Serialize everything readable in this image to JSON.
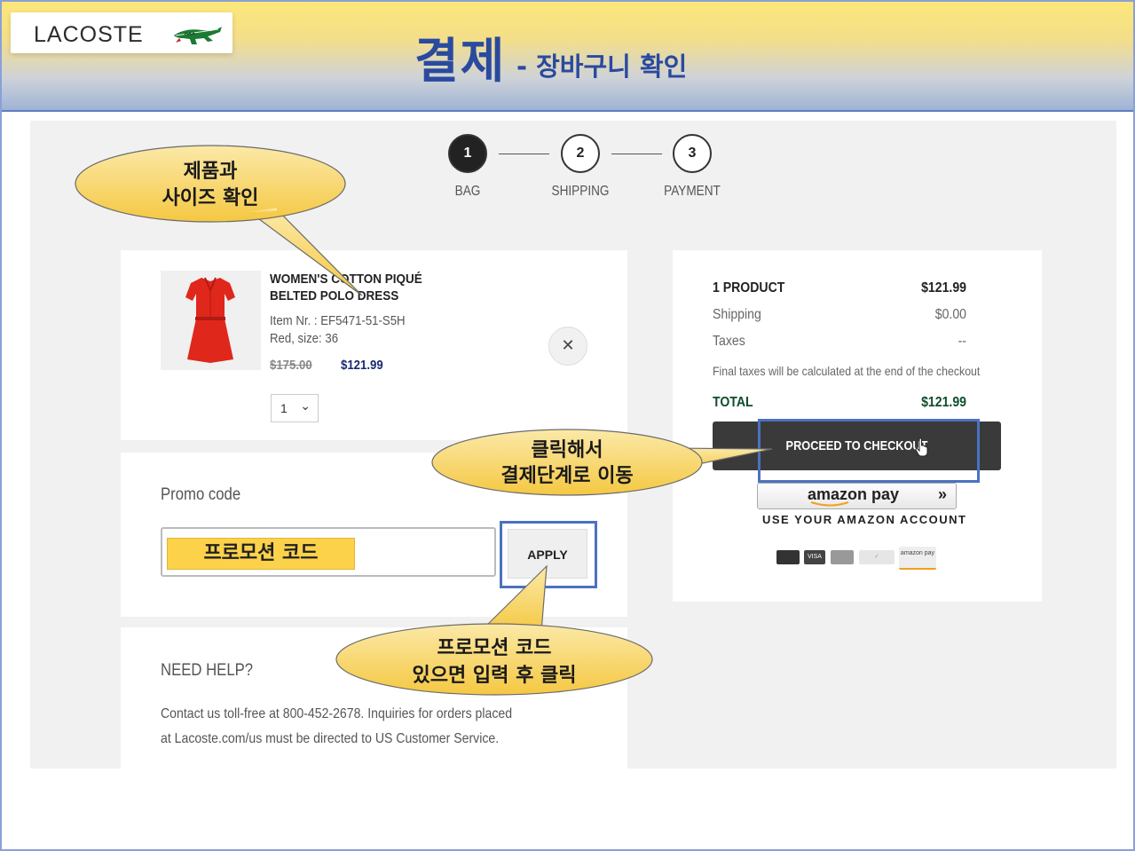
{
  "header": {
    "logo_text": "LACOSTE",
    "title": "결제",
    "subtitle": "- 장바구니 확인",
    "colors": {
      "title": "#2a4aa0",
      "band_top": "#fde77a",
      "band_bottom": "#9fb3d6"
    }
  },
  "steps": [
    {
      "number": "1",
      "label": "BAG",
      "active": true
    },
    {
      "number": "2",
      "label": "SHIPPING",
      "active": false
    },
    {
      "number": "3",
      "label": "PAYMENT",
      "active": false
    }
  ],
  "product": {
    "image_icon": "red-polo-dress-image",
    "name": "WOMEN'S COTTON PIQUÉ BELTED POLO DRESS",
    "item_nr": "Item Nr. : EF5471-51-S5H",
    "variant": "Red, size: 36",
    "price_old": "$175.00",
    "price_new": "$121.99",
    "quantity": "1",
    "remove_icon": "close-icon"
  },
  "promo": {
    "label": "Promo code",
    "placeholder": "프로모션 코드",
    "apply_label": "APPLY"
  },
  "help": {
    "title": "NEED HELP?",
    "text": "Contact us toll-free at 800-452-2678. Inquiries for orders placed at Lacoste.com/us must be directed to US Customer Service."
  },
  "summary": {
    "product_label": "1 PRODUCT",
    "product_value": "$121.99",
    "shipping_label": "Shipping",
    "shipping_value": "$0.00",
    "taxes_label": "Taxes",
    "taxes_value": "--",
    "final_note": "Final taxes will be calculated at the end of the checkout",
    "total_label": "TOTAL",
    "total_value": "$121.99",
    "total_color": "#0e4d2a",
    "checkout_label": "PROCEED TO CHECKOUT",
    "amazon_label": "amazon pay",
    "amazon_arrows": "»",
    "amazon_sub": "USE YOUR AMAZON ACCOUNT",
    "payment_icons": [
      "card-icon",
      "visa-icon",
      "mastercard-icon",
      "verified-icon",
      "amazon-pay-icon"
    ],
    "amazon_pay_badge": "amazon pay"
  },
  "callouts": {
    "product_check": [
      "제품과",
      "사이즈 확인"
    ],
    "checkout_click": [
      "클릭해서",
      "결제단계로 이동"
    ],
    "promo_click": [
      "프로모션 코드",
      "있으면 입력 후 클릭"
    ]
  }
}
